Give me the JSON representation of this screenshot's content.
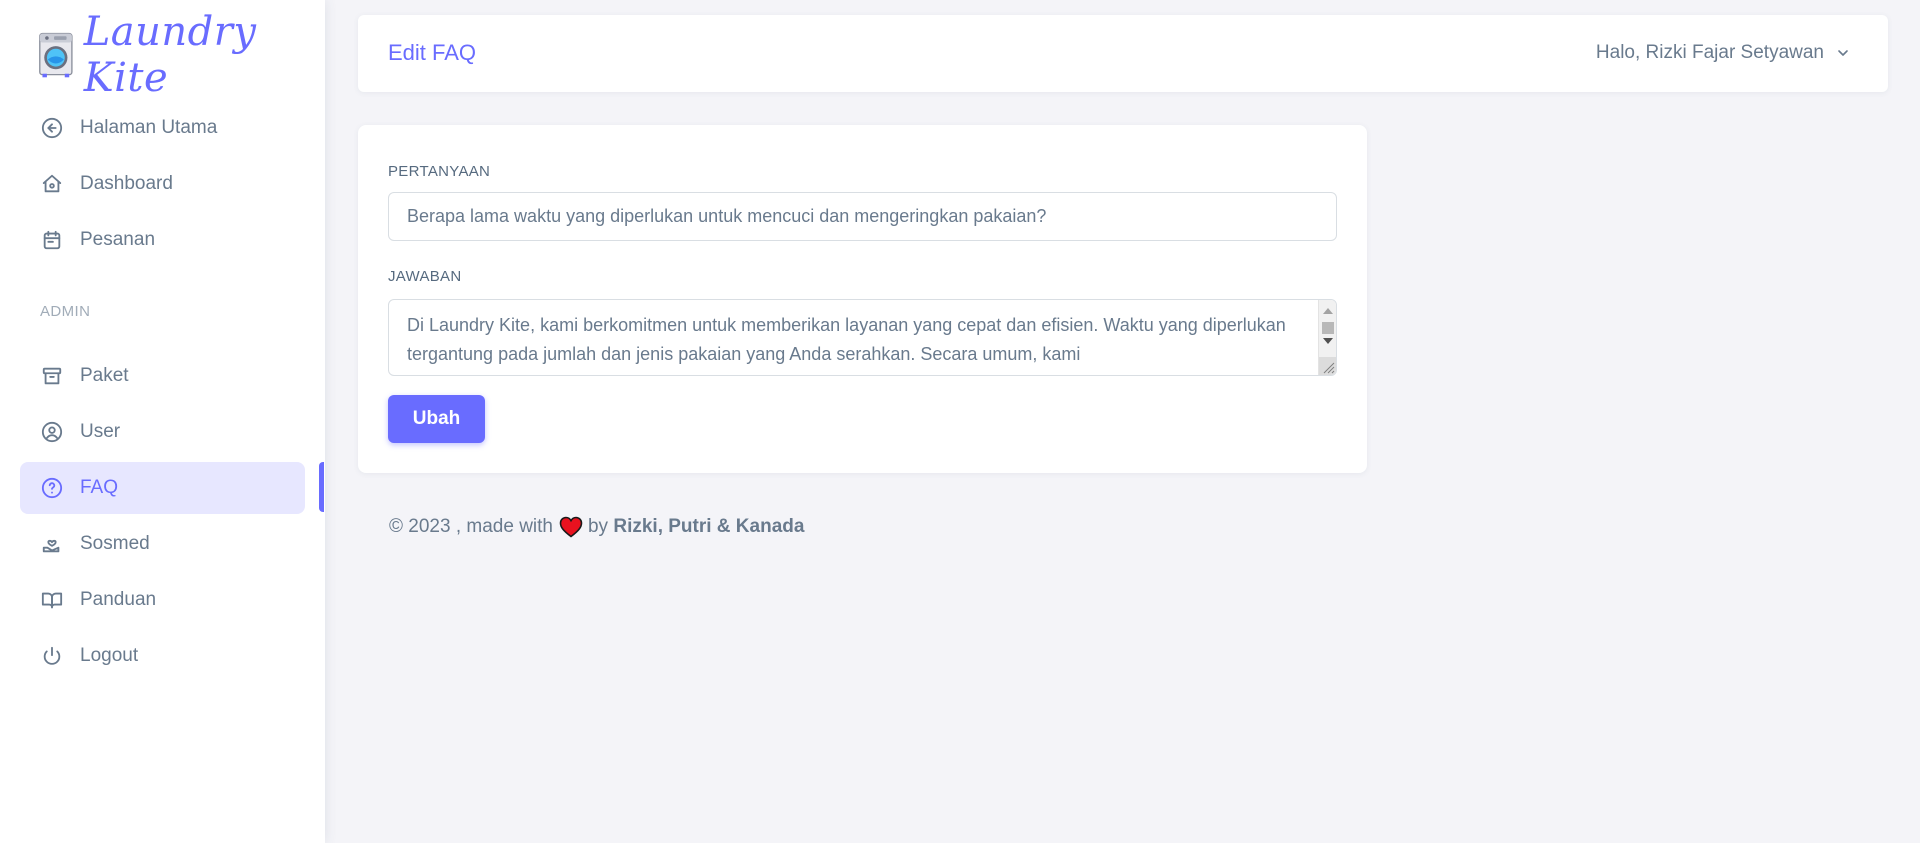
{
  "brand": {
    "name": "Laundry Kite",
    "logo_icon": "washing-machine-icon"
  },
  "sidebar": {
    "items": [
      {
        "label": "Halaman Utama",
        "icon": "arrow-left-circle-icon"
      },
      {
        "label": "Dashboard",
        "icon": "home-icon"
      },
      {
        "label": "Pesanan",
        "icon": "calendar-icon"
      }
    ],
    "admin_header": "ADMIN",
    "admin_items": [
      {
        "label": "Paket",
        "icon": "archive-icon"
      },
      {
        "label": "User",
        "icon": "user-circle-icon"
      },
      {
        "label": "FAQ",
        "icon": "help-circle-icon",
        "active": true
      },
      {
        "label": "Sosmed",
        "icon": "hand-heart-icon"
      },
      {
        "label": "Panduan",
        "icon": "book-icon"
      },
      {
        "label": "Logout",
        "icon": "power-icon"
      }
    ]
  },
  "navbar": {
    "title": "Edit FAQ",
    "user_greeting": "Halo, Rizki Fajar Setyawan"
  },
  "form": {
    "question_label": "PERTANYAAN",
    "question_value": "Berapa lama waktu yang diperlukan untuk mencuci dan mengeringkan pakaian?",
    "answer_label": "JAWABAN",
    "answer_value": "Di Laundry Kite, kami berkomitmen untuk memberikan layanan yang cepat dan efisien. Waktu yang diperlukan tergantung pada jumlah dan jenis pakaian yang Anda serahkan. Secara umum, kami",
    "submit_label": "Ubah"
  },
  "footer": {
    "prefix": "© 2023 , made with",
    "by": "by",
    "authors": "Rizki, Putri & Kanada"
  },
  "colors": {
    "accent": "#696cff",
    "text": "#697a8d",
    "background": "#f4f4f8"
  }
}
